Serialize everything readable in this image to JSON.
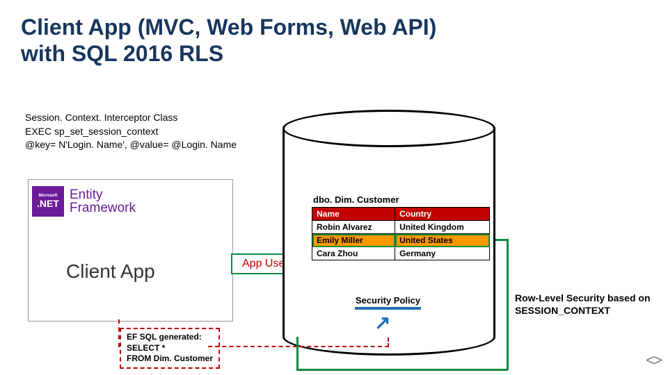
{
  "title_line1": "Client App (MVC, Web Forms, Web API)",
  "title_line2": "with SQL 2016 RLS",
  "subtitle_line1": "Session. Context. Interceptor Class",
  "subtitle_line2": "EXEC sp_set_session_context",
  "subtitle_line3": "@key= N'Login. Name', @value= @Login. Name",
  "ef": {
    "ms": "Microsoft",
    "net": ".NET",
    "text1": "Entity",
    "text2": "Framework"
  },
  "clientapp": "Client App",
  "appuser": "App User",
  "table": {
    "caption": "dbo. Dim. Customer",
    "headers": [
      "Name",
      "Country"
    ],
    "rows": [
      {
        "name": "Robin Alvarez",
        "country": "United Kingdom",
        "hl": false
      },
      {
        "name": "Emily Miller",
        "country": "United States",
        "hl": true
      },
      {
        "name": "Cara Zhou",
        "country": "Germany",
        "hl": false
      }
    ]
  },
  "security_policy": "Security Policy",
  "rls_line1": "Row-Level Security based on",
  "rls_line2": "SESSION_CONTEXT",
  "sql_line1": "EF SQL generated:",
  "sql_line2": "SELECT *",
  "sql_line3": "FROM Dim. Customer",
  "nav_prev": "<",
  "nav_next": ">"
}
